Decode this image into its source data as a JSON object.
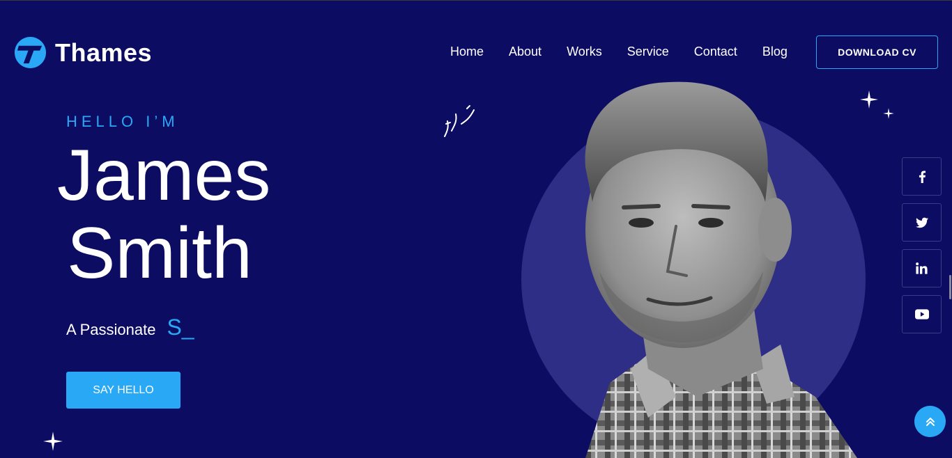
{
  "brand": {
    "name": "Thames",
    "accent_color": "#2aa8f6",
    "background_color": "#0c0c62"
  },
  "nav": {
    "items": [
      {
        "label": "Home"
      },
      {
        "label": "About"
      },
      {
        "label": "Works"
      },
      {
        "label": "Service"
      },
      {
        "label": "Contact"
      },
      {
        "label": "Blog"
      }
    ],
    "cta_label": "DOWNLOAD CV"
  },
  "hero": {
    "greeting": "HELLO I’M",
    "name_line1": "James",
    "name_line2": "Smith",
    "tagline_prefix": "A Passionate",
    "tagline_typed": "S_",
    "button_label": "SAY HELLO"
  },
  "social": {
    "items": [
      {
        "icon": "facebook-icon"
      },
      {
        "icon": "twitter-icon"
      },
      {
        "icon": "linkedin-icon"
      },
      {
        "icon": "youtube-icon"
      }
    ]
  },
  "back_to_top": {
    "icon": "double-chevron-up-icon"
  }
}
